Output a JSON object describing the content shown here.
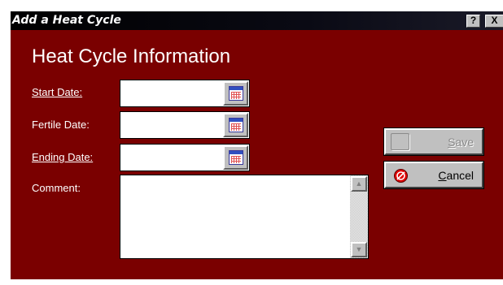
{
  "window": {
    "title": "Add a Heat Cycle",
    "help_label": "?",
    "close_label": "X"
  },
  "heading": "Heat Cycle Information",
  "fields": {
    "start_date": {
      "label": "Start Date:",
      "value": ""
    },
    "fertile_date": {
      "label": "Fertile Date:",
      "value": ""
    },
    "ending_date": {
      "label": "Ending Date:",
      "value": ""
    },
    "comment": {
      "label": "Comment:",
      "value": ""
    }
  },
  "buttons": {
    "save": {
      "accel": "S",
      "rest": "ave",
      "enabled": false
    },
    "cancel": {
      "accel": "C",
      "rest": "ancel",
      "enabled": true
    }
  },
  "icons": {
    "date_picker": "calendar-icon",
    "save": "save-icon",
    "cancel": "cancel-icon"
  },
  "colors": {
    "dialog_background": "#7a0000",
    "titlebar": "#000000",
    "label_text": "#ffffff"
  }
}
